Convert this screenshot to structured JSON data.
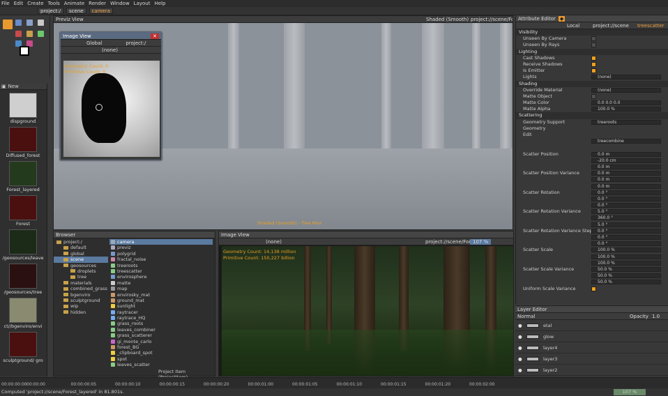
{
  "menu": [
    "File",
    "Edit",
    "Create",
    "Tools",
    "Animate",
    "Render",
    "Window",
    "Layout",
    "Help"
  ],
  "path": {
    "crumbs": [
      "project:/",
      "scene"
    ],
    "current": "camera"
  },
  "shelf": {
    "header": "New",
    "items": [
      {
        "label": "dispground",
        "thumb": "#cfcfcf"
      },
      {
        "label": "Diffused_forest",
        "thumb": "#4a1010"
      },
      {
        "label": "Forest_layered",
        "thumb": "#243a1c"
      },
      {
        "label": "Forest",
        "thumb": "#4a1010"
      },
      {
        "label": "/geosources/leave",
        "thumb": "#1c2a18"
      },
      {
        "label": "/geosources/tree",
        "thumb": "#2a1010"
      },
      {
        "label": "ct//bgenviro/envi",
        "thumb": "#8a8a70"
      },
      {
        "label": "sculptground/ gro",
        "thumb": "#4a1010"
      }
    ]
  },
  "viewport": {
    "title": "Previz View",
    "shading": "Shaded (Smooth)",
    "path": "project://scene/Fo",
    "overlay": "Shaded (Smooth) - Tree Max"
  },
  "imageview_small": {
    "title": "Image View",
    "mode": "Global",
    "path": "project:/",
    "dropdown": "(none)",
    "overlay1": "Geometry Count: 0",
    "overlay2": "Primitive Count: 0"
  },
  "browser": {
    "title": "Browser",
    "tree": [
      {
        "label": "project:/",
        "depth": 0
      },
      {
        "label": "default",
        "depth": 1
      },
      {
        "label": "global",
        "depth": 1
      },
      {
        "label": "scene",
        "depth": 1,
        "selected": true
      },
      {
        "label": "geosources",
        "depth": 1
      },
      {
        "label": "droplets",
        "depth": 2
      },
      {
        "label": "tree",
        "depth": 2
      },
      {
        "label": "materials",
        "depth": 1
      },
      {
        "label": "combined_grass",
        "depth": 1
      },
      {
        "label": "bgenviro",
        "depth": 1
      },
      {
        "label": "sculptground",
        "depth": 1
      },
      {
        "label": "wip",
        "depth": 1
      },
      {
        "label": "hidden",
        "depth": 1
      }
    ],
    "items": [
      {
        "label": "camera",
        "color": "#9ab",
        "selected": true
      },
      {
        "label": "previz",
        "color": "#aab"
      },
      {
        "label": "polygrid",
        "color": "#79c"
      },
      {
        "label": "fractal_noise",
        "color": "#c8a"
      },
      {
        "label": "treeroots",
        "color": "#8c8"
      },
      {
        "label": "treescatter",
        "color": "#8c8"
      },
      {
        "label": "envirosphere",
        "color": "#79c"
      },
      {
        "label": "matte",
        "color": "#ccc"
      },
      {
        "label": "map",
        "color": "#999"
      },
      {
        "label": "envirosky_mat",
        "color": "#c96"
      },
      {
        "label": "ground_mat",
        "color": "#c96"
      },
      {
        "label": "sunlight",
        "color": "#ec4"
      },
      {
        "label": "raytracer",
        "color": "#7ae"
      },
      {
        "label": "raytrace_HQ",
        "color": "#7ae"
      },
      {
        "label": "grass_roots",
        "color": "#8c8"
      },
      {
        "label": "leaves_combiner",
        "color": "#8c8"
      },
      {
        "label": "grass_scatterer",
        "color": "#8c8"
      },
      {
        "label": "gi_monte_carlo",
        "color": "#c6c"
      },
      {
        "label": "forest_BG",
        "color": "#c96"
      },
      {
        "label": "_clipboard_spot",
        "color": "#ec4"
      },
      {
        "label": "spot",
        "color": "#ec4"
      },
      {
        "label": "leaves_scatter",
        "color": "#8c8"
      },
      {
        "label": "leaves_root",
        "color": "#8c8"
      }
    ],
    "footer": "Project Item (ProjectItem)"
  },
  "imageview_big": {
    "title": "Image View",
    "dropdown": "(none)",
    "path": "project://scene/Forest",
    "zoom": "107 %",
    "overlay1": "Geometry Count: 14,138 million",
    "overlay2": "Primitive Count: 150,227 billion"
  },
  "attributes": {
    "title": "Attribute Editor",
    "space": "Local",
    "path": "project://scene",
    "current": "treescatter",
    "rows": [
      {
        "type": "sec",
        "label": "Visibility"
      },
      {
        "type": "chk",
        "label": "Unseen By Camera",
        "on": false
      },
      {
        "type": "chk",
        "label": "Unseen By Rays",
        "on": false
      },
      {
        "type": "sec",
        "label": "Lighting"
      },
      {
        "type": "chk",
        "label": "Cast Shadows",
        "on": true
      },
      {
        "type": "chk",
        "label": "Receive Shadows",
        "on": true
      },
      {
        "type": "chk",
        "label": "Is Emitter",
        "on": true
      },
      {
        "type": "field",
        "label": "Lights",
        "value": "(none)"
      },
      {
        "type": "sec",
        "label": "Shading"
      },
      {
        "type": "field",
        "label": "Override Material",
        "value": "(none)"
      },
      {
        "type": "chk",
        "label": "Matte Object",
        "on": false
      },
      {
        "type": "field",
        "label": "Matte Color",
        "value": "0.0    0.0    0.0"
      },
      {
        "type": "field",
        "label": "Matte Alpha",
        "value": "100.0 %"
      },
      {
        "type": "sec",
        "label": "Scattering"
      },
      {
        "type": "field",
        "label": "Geometry Support",
        "value": "treeroots"
      },
      {
        "type": "plain",
        "label": "Geometry"
      },
      {
        "type": "plain",
        "label": "Edit"
      },
      {
        "type": "field",
        "label": "",
        "value": "treecombine"
      },
      {
        "type": "plain",
        "label": ""
      },
      {
        "type": "field",
        "label": "Scatter Position",
        "value": "0.0 m"
      },
      {
        "type": "field",
        "label": "",
        "value": "-20.0 cm"
      },
      {
        "type": "field",
        "label": "",
        "value": "0.0 m"
      },
      {
        "type": "field",
        "label": "Scatter Position Variance",
        "value": "0.0 m"
      },
      {
        "type": "field",
        "label": "",
        "value": "0.0 m"
      },
      {
        "type": "field",
        "label": "",
        "value": "0.0 m"
      },
      {
        "type": "field",
        "label": "Scatter Rotation",
        "value": "0.0 °"
      },
      {
        "type": "field",
        "label": "",
        "value": "0.0 °"
      },
      {
        "type": "field",
        "label": "",
        "value": "0.0 °"
      },
      {
        "type": "field",
        "label": "Scatter Rotation Variance",
        "value": "5.0 °"
      },
      {
        "type": "field",
        "label": "",
        "value": "360.0 °"
      },
      {
        "type": "field",
        "label": "",
        "value": "5.0 °"
      },
      {
        "type": "field",
        "label": "Scatter Rotation Variance Step",
        "value": "0.0 °"
      },
      {
        "type": "field",
        "label": "",
        "value": "0.0 °"
      },
      {
        "type": "field",
        "label": "",
        "value": "0.0 °"
      },
      {
        "type": "field",
        "label": "Scatter Scale",
        "value": "100.0 %"
      },
      {
        "type": "field",
        "label": "",
        "value": "100.0 %"
      },
      {
        "type": "field",
        "label": "",
        "value": "100.0 %"
      },
      {
        "type": "field",
        "label": "Scatter Scale Variance",
        "value": "50.0 %"
      },
      {
        "type": "field",
        "label": "",
        "value": "50.0 %"
      },
      {
        "type": "field",
        "label": "",
        "value": "50.0 %"
      },
      {
        "type": "chk",
        "label": "Uniform Scale Variance",
        "on": true
      }
    ]
  },
  "layers": {
    "title": "Layer Editor",
    "blend": "Normal",
    "opacity_label": "Opacity",
    "opacity": "1.0",
    "items": [
      "etal",
      "glow",
      "layer4",
      "layer3",
      "layer2"
    ]
  },
  "timeline": {
    "start": "00:00:00:00",
    "ticks": [
      "00:00:00",
      "00:00:00:05",
      "00:00:00:10",
      "00:00:00:15",
      "00:00:00:20",
      "00:00:01:00",
      "00:00:01:05",
      "00:00:01:10",
      "00:00:01:15",
      "00:00:01:20",
      "00:00:02:00"
    ],
    "end": "00:00:02:00"
  },
  "status": {
    "text": "Computed 'project://scene/Forest_layered' in 81.801s.",
    "right": "107 %"
  }
}
